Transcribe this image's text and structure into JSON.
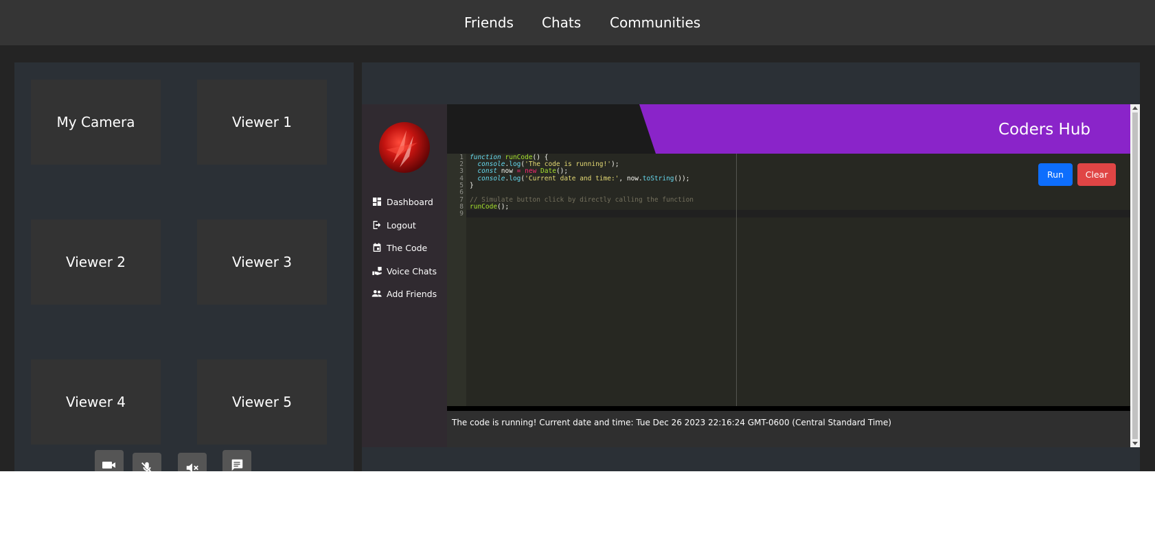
{
  "nav": {
    "friends": "Friends",
    "chats": "Chats",
    "communities": "Communities"
  },
  "video_tiles": [
    {
      "label": "My Camera"
    },
    {
      "label": "Viewer 1"
    },
    {
      "label": "Viewer 2"
    },
    {
      "label": "Viewer 3"
    },
    {
      "label": "Viewer 4"
    },
    {
      "label": "Viewer 5"
    }
  ],
  "controls": [
    {
      "icon": "camera-icon"
    },
    {
      "icon": "mic-off-icon"
    },
    {
      "icon": "volume-off-icon"
    },
    {
      "icon": "chat-icon"
    }
  ],
  "sidebar": {
    "items": [
      {
        "label": "Dashboard",
        "icon": "dashboard-icon"
      },
      {
        "label": "Logout",
        "icon": "logout-icon"
      },
      {
        "label": "The Code",
        "icon": "calendar-icon"
      },
      {
        "label": "Voice Chats",
        "icon": "voice-chat-icon"
      },
      {
        "label": "Add Friends",
        "icon": "people-icon"
      }
    ]
  },
  "header": {
    "title": "Coders Hub",
    "accent_color": "#8a24c9"
  },
  "editor": {
    "line_numbers": [
      "1",
      "2",
      "3",
      "4",
      "5",
      "6",
      "7",
      "8",
      "9"
    ],
    "lines": [
      "function runCode() {",
      "  console.log('The code is running!');",
      "  const now = new Date();",
      "  console.log('Current date and time:', now.toString());",
      "}",
      "",
      "// Simulate button click by directly calling the function",
      "runCode();",
      ""
    ]
  },
  "buttons": {
    "run": "Run",
    "clear": "Clear",
    "run_color": "#0d6efd",
    "clear_color": "#e04545"
  },
  "output": {
    "text": "The code is running! Current date and time: Tue Dec 26 2023 22:16:24 GMT-0600 (Central Standard Time)"
  }
}
